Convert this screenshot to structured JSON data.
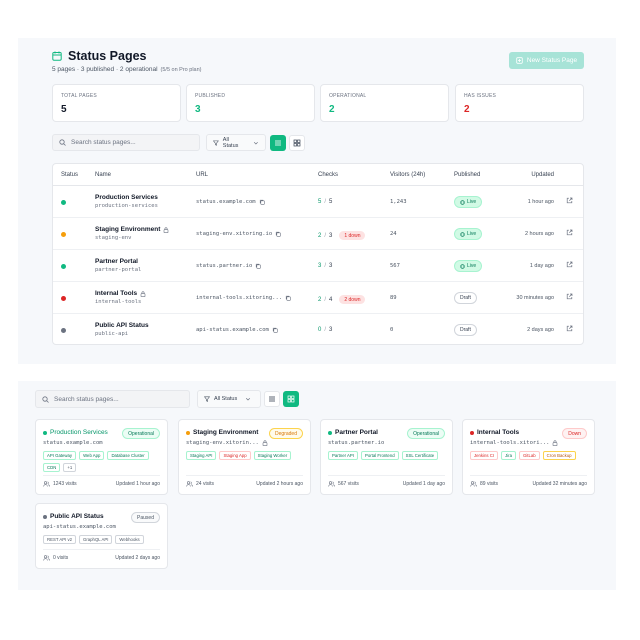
{
  "header": {
    "title": "Status Pages",
    "subtitle": "5 pages · 3 published · 2 operational",
    "plan": "(5/5 on Pro plan)",
    "new_button": "New Status Page"
  },
  "stats": [
    {
      "label": "Total Pages",
      "value": "5",
      "color": "#111827"
    },
    {
      "label": "Published",
      "value": "3",
      "color": "#10b981"
    },
    {
      "label": "Operational",
      "value": "2",
      "color": "#10b981"
    },
    {
      "label": "Has Issues",
      "value": "2",
      "color": "#dc2626"
    }
  ],
  "toolbar": {
    "search_placeholder": "Search status pages...",
    "filter_label": "All Status"
  },
  "table": {
    "headers": [
      "Status",
      "Name",
      "URL",
      "Checks",
      "Visitors (24h)",
      "Published",
      "Updated"
    ],
    "rows": [
      {
        "status_color": "#10b981",
        "name": "Production Services",
        "slug": "production-services",
        "locked": false,
        "url": "status.example.com",
        "checks_ok": "5",
        "checks_total": "5",
        "down": "",
        "visitors": "1,243",
        "published": "Live",
        "updated": "1 hour ago"
      },
      {
        "status_color": "#f59e0b",
        "name": "Staging Environment",
        "slug": "staging-env",
        "locked": true,
        "url": "staging-env.xitoring.io",
        "checks_ok": "2",
        "checks_total": "3",
        "down": "1 down",
        "visitors": "24",
        "published": "Live",
        "updated": "2 hours ago"
      },
      {
        "status_color": "#10b981",
        "name": "Partner Portal",
        "slug": "partner-portal",
        "locked": false,
        "url": "status.partner.io",
        "checks_ok": "3",
        "checks_total": "3",
        "down": "",
        "visitors": "567",
        "published": "Live",
        "updated": "1 day ago"
      },
      {
        "status_color": "#dc2626",
        "name": "Internal Tools",
        "slug": "internal-tools",
        "locked": true,
        "url": "internal-tools.xitoring...",
        "checks_ok": "2",
        "checks_total": "4",
        "down": "2 down",
        "visitors": "89",
        "published": "Draft",
        "updated": "30 minutes ago"
      },
      {
        "status_color": "#6b7280",
        "name": "Public API Status",
        "slug": "public-api",
        "locked": false,
        "url": "api-status.example.com",
        "checks_ok": "0",
        "checks_total": "3",
        "down": "",
        "visitors": "0",
        "published": "Draft",
        "updated": "2 days ago"
      }
    ]
  },
  "grid": {
    "cards": [
      {
        "name": "Production Services",
        "name_color": "#059669",
        "dot": "#10b981",
        "badge": "Operational",
        "badge_style": "green",
        "url": "status.example.com",
        "locked": false,
        "tags": [
          "API Gateway",
          "Web App",
          "Database Cluster",
          "CDN",
          "+1"
        ],
        "tag_style": "green",
        "visits": "1243 visits",
        "updated": "Updated 1 hour ago"
      },
      {
        "name": "Staging Environment",
        "name_color": "#111827",
        "dot": "#f59e0b",
        "badge": "Degraded",
        "badge_style": "amber",
        "url": "staging-env.xitorin...",
        "locked": true,
        "tags": [
          "Staging API",
          "Staging App",
          "Staging Worker"
        ],
        "tag_style": "mixed-a",
        "visits": "24 visits",
        "updated": "Updated 2 hours ago"
      },
      {
        "name": "Partner Portal",
        "name_color": "#111827",
        "dot": "#10b981",
        "badge": "Operational",
        "badge_style": "green",
        "url": "status.partner.io",
        "locked": false,
        "tags": [
          "Partner API",
          "Portal Frontend",
          "SSL Certificate"
        ],
        "tag_style": "green",
        "visits": "567 visits",
        "updated": "Updated 1 day ago"
      },
      {
        "name": "Internal Tools",
        "name_color": "#111827",
        "dot": "#dc2626",
        "badge": "Down",
        "badge_style": "red",
        "url": "internal-tools.xitori...",
        "locked": true,
        "tags": [
          "Jenkins CI",
          "Jira",
          "GitLab",
          "Cron Backup"
        ],
        "tag_style": "mixed-b",
        "visits": "89 visits",
        "updated": "Updated 32 minutes ago"
      },
      {
        "name": "Public API Status",
        "name_color": "#111827",
        "dot": "#6b7280",
        "badge": "Paused",
        "badge_style": "gray",
        "url": "api-status.example.com",
        "locked": false,
        "tags": [
          "REST API v2",
          "GraphQL API",
          "Webhooks"
        ],
        "tag_style": "gray",
        "visits": "0 visits",
        "updated": "Updated 2 days ago"
      }
    ]
  },
  "colors": {
    "accent": "#10b981",
    "accent_light": "#a7e3d7",
    "danger": "#dc2626",
    "warning": "#f59e0b"
  },
  "icons": [
    "calendar-icon",
    "plus-icon",
    "search-icon",
    "filter-icon",
    "chevron-down-icon",
    "list-icon",
    "grid-icon",
    "lock-icon",
    "copy-icon",
    "external-link-icon",
    "users-icon"
  ]
}
